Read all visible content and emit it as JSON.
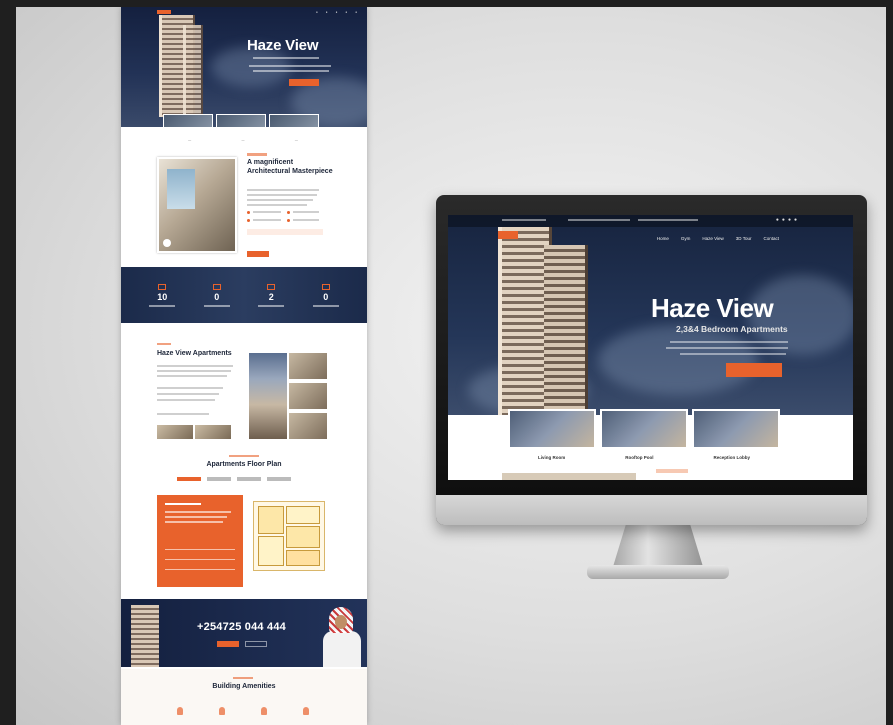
{
  "colors": {
    "accent": "#e8622c",
    "navy": "#1b2a4a",
    "stage": "#e4e4e4"
  },
  "long_page": {
    "brand": "Haze View",
    "hero_title": "Haze View",
    "stats": [
      "10",
      "0",
      "2",
      "0"
    ],
    "apartments_title": "Haze View Apartments",
    "about_title": "A magnificent Architectural Masterpiece",
    "floor_title": "Apartments Floor Plan",
    "phone": "+254725 044 444",
    "amenities_title": "Building Amenities"
  },
  "monitor": {
    "hero_title": "Haze View",
    "hero_subtitle": "2,3&4 Bedroom Apartments",
    "nav_items": [
      "Home",
      "Gym",
      "Haze View",
      "3D Tour",
      "Contact"
    ],
    "thumb_captions": [
      "Living Room",
      "Rooftop Pool",
      "Reception Lobby"
    ],
    "social_icons": [
      "facebook-icon",
      "twitter-icon",
      "instagram-icon",
      "linkedin-icon"
    ]
  }
}
